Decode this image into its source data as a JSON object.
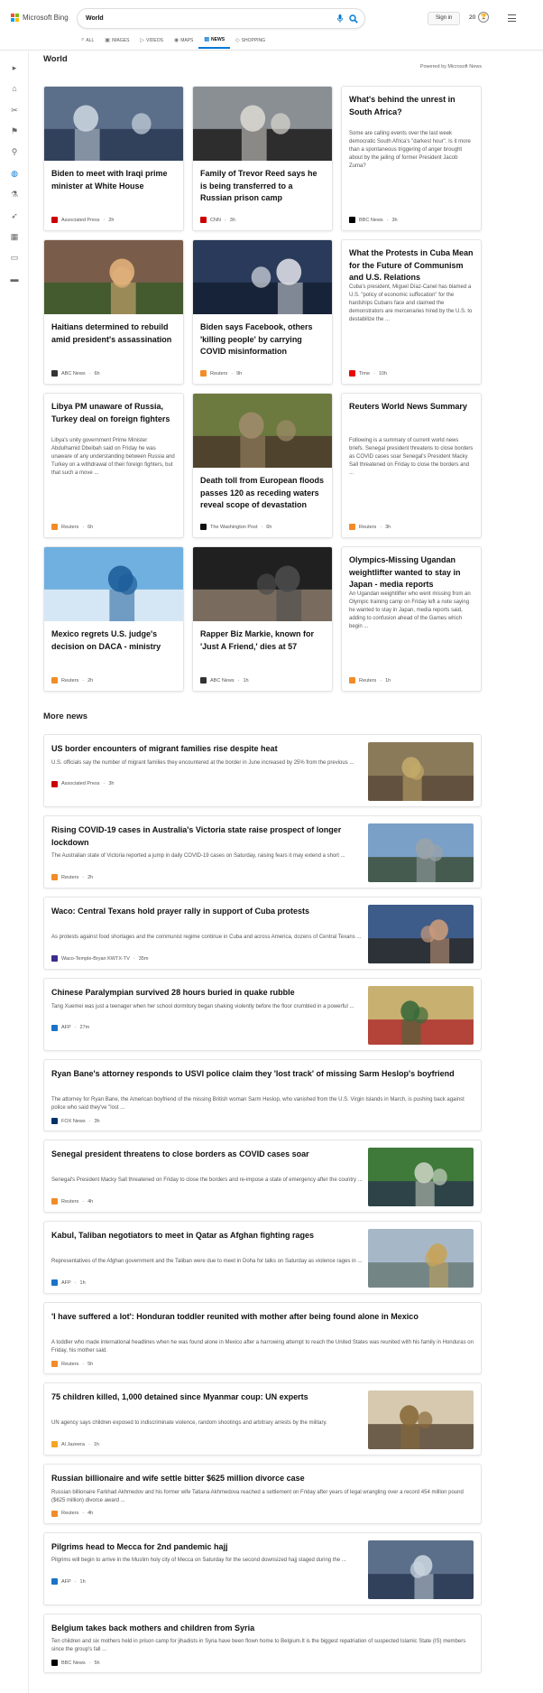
{
  "header": {
    "logo_text": "Microsoft Bing",
    "search_value": "World",
    "signin_label": "Sign in",
    "rewards_count": "20",
    "tabs": [
      {
        "label": "ALL",
        "icon": "search-icon"
      },
      {
        "label": "IMAGES",
        "icon": "image-icon"
      },
      {
        "label": "VIDEOS",
        "icon": "video-icon"
      },
      {
        "label": "MAPS",
        "icon": "map-pin-icon"
      },
      {
        "label": "NEWS",
        "icon": "news-icon",
        "active": true
      },
      {
        "label": "SHOPPING",
        "icon": "tag-icon"
      }
    ]
  },
  "sidebar": {
    "icons": [
      "chevron-right-icon",
      "home-icon",
      "tools-icon",
      "flag-icon",
      "location-pin-icon",
      "globe-icon",
      "science-icon",
      "rocket-icon",
      "film-icon",
      "briefcase-icon",
      "car-icon"
    ]
  },
  "world": {
    "title": "World",
    "powered_by": "Powered by Microsoft News",
    "cards": [
      {
        "title": "Biden to meet with Iraqi prime minister at White House",
        "source": "Associated Press",
        "age": "2h",
        "has_image": true
      },
      {
        "title": "Family of Trevor Reed says he is being transferred to a Russian prison camp",
        "source": "CNN",
        "age": "3h",
        "has_image": true
      },
      {
        "title": "What's behind the unrest in South Africa?",
        "desc": "Some are calling events over the last week democratic South Africa's \"darkest hour\". Is it more than a spontaneous triggering of anger brought about by the jailing of former President Jacob Zuma?",
        "source": "BBC News",
        "age": "3h",
        "has_image": false
      },
      {
        "title": "Haitians determined to rebuild amid president's assassination",
        "source": "ABC News",
        "age": "6h",
        "has_image": true
      },
      {
        "title": "Biden says Facebook, others 'killing people' by carrying COVID misinformation",
        "source": "Reuters",
        "age": "9h",
        "has_image": true
      },
      {
        "title": "What the Protests in Cuba Mean for the Future of Communism and U.S. Relations",
        "desc": "Cuba's president, Miguel Díaz-Canel has blamed a U.S. \"policy of economic suffocation\" for the hardships Cubans face and claimed the demonstrators are mercenaries hired by the U.S. to destabilize the ...",
        "source": "Time",
        "age": "10h",
        "has_image": false
      },
      {
        "title": "Libya PM unaware of Russia, Turkey deal on foreign fighters",
        "desc": "Libya's unity government Prime Minister Abdulhamid Dbeibah said on Friday he was unaware of any understanding between Russia and Turkey on a withdrawal of their foreign fighters, but that such a move ...",
        "source": "Reuters",
        "age": "6h",
        "has_image": false
      },
      {
        "title": "Death toll from European floods passes 120 as receding waters reveal scope of devastation",
        "source": "The Washington Post",
        "age": "6h",
        "has_image": true
      },
      {
        "title": "Reuters World News Summary",
        "desc": "Following is a summary of current world news briefs. Senegal president threatens to close borders as COVID cases soar Senegal's President Macky Sall threatened on Friday to close the borders and ...",
        "source": "Reuters",
        "age": "3h",
        "has_image": false
      },
      {
        "title": "Mexico regrets U.S. judge's decision on DACA - ministry",
        "source": "Reuters",
        "age": "2h",
        "has_image": true
      },
      {
        "title": "Rapper Biz Markie, known for 'Just A Friend,' dies at 57",
        "source": "ABC News",
        "age": "1h",
        "has_image": true
      },
      {
        "title": "Olympics-Missing Ugandan weightlifter wanted to stay in Japan - media reports",
        "desc": "An Ugandan weightlifter who went missing from an Olympic training camp on Friday left a note saying he wanted to stay in Japan, media reports said, adding to confusion ahead of the Games which begin ...",
        "source": "Reuters",
        "age": "1h",
        "has_image": false
      }
    ]
  },
  "more_news": {
    "title": "More news",
    "items": [
      {
        "title": "US border encounters of migrant families rise despite heat",
        "desc": "U.S. officials say the number of migrant families they encountered at the border in June increased by 25% from the previous ...",
        "source": "Associated Press",
        "age": "3h",
        "has_image": true
      },
      {
        "title": "Rising COVID-19 cases in Australia's Victoria state raise prospect of longer lockdown",
        "desc": "The Australian state of Victoria reported a jump in daily COVID-19 cases on Saturday, raising fears it may extend a short ...",
        "source": "Reuters",
        "age": "2h",
        "has_image": true
      },
      {
        "title": "Waco: Central Texans hold prayer rally in support of Cuba protests",
        "desc": "As protests against food shortages and the communist regime continue in Cuba and across America, dozens of Central Texans ...",
        "source": "Waco-Temple-Bryan KWTX-TV",
        "age": "35m",
        "has_image": true
      },
      {
        "title": "Chinese Paralympian survived 28 hours buried in quake rubble",
        "desc": "Tang Xuemei was just a teenager when her school dormitory began shaking violently before the floor crumbled in a powerful ...",
        "source": "AFP",
        "age": "27m",
        "has_image": true
      },
      {
        "title": "Ryan Bane's attorney responds to USVI police claim they 'lost track' of missing Sarm Heslop's boyfriend",
        "desc": "The attorney for Ryan Bane, the American boyfriend of the missing British woman Sarm Heslop, who vanished from the U.S. Virgin Islands in March, is pushing back against police who said they've \"lost ...",
        "source": "FOX News",
        "age": "3h",
        "has_image": false
      },
      {
        "title": "Senegal president threatens to close borders as COVID cases soar",
        "desc": "Senegal's President Macky Sall threatened on Friday to close the borders and re-impose a state of emergency after the country ...",
        "source": "Reuters",
        "age": "4h",
        "has_image": true
      },
      {
        "title": "Kabul, Taliban negotiators to meet in Qatar as Afghan fighting rages",
        "desc": "Representatives of the Afghan government and the Taliban were due to meet in Doha for talks on Saturday as violence rages in ...",
        "source": "AFP",
        "age": "1h",
        "has_image": true
      },
      {
        "title": "'I have suffered a lot': Honduran toddler reunited with mother after being found alone in Mexico",
        "desc": "A toddler who made international headlines when he was found alone in Mexico after a harrowing attempt to reach the United States was reunited with his family in Honduras on Friday, his mother said.",
        "source": "Reuters",
        "age": "5h",
        "has_image": false
      },
      {
        "title": "75 children killed, 1,000 detained since Myanmar coup: UN experts",
        "desc": "UN agency says children exposed to indiscriminate violence, random shootings and arbitrary arrests by the military.",
        "source": "Al Jazeera",
        "age": "1h",
        "has_image": true
      },
      {
        "title": "Russian billionaire and wife settle bitter $625 million divorce case",
        "desc": "Russian billionaire Farkhad Akhmedov and his former wife Tatiana Akhmedova reached a settlement on Friday after years of legal wrangling over a record 454 million pound ($625 million) divorce award ...",
        "source": "Reuters",
        "age": "4h",
        "has_image": false
      },
      {
        "title": "Pilgrims head to Mecca for 2nd pandemic hajj",
        "desc": "Pilgrims will begin to arrive in the Muslim holy city of Mecca on Saturday for the second downsized hajj staged during the ...",
        "source": "AFP",
        "age": "1h",
        "has_image": true
      },
      {
        "title": "Belgium takes back mothers and children from Syria",
        "desc": "Ten children and six mothers held in prison camp for jihadists in Syria have been flown home to Belgium.It is the biggest repatriation of suspected Islamic State (IS) members since the group's fall ...",
        "source": "BBC News",
        "age": "5h",
        "has_image": false
      }
    ]
  },
  "colors": {
    "accent": "#0078d4",
    "source_ap": "#cc0000",
    "source_cnn": "#cc0000",
    "source_reuters": "#f28c28",
    "source_abc": "#333333",
    "source_time": "#e90606",
    "source_bbc": "#000000",
    "source_wapo": "#111111",
    "source_afp": "#1a73c8",
    "source_fox": "#003366",
    "source_aljazeera": "#f5a623",
    "source_kwtx": "#3d2c8d"
  }
}
